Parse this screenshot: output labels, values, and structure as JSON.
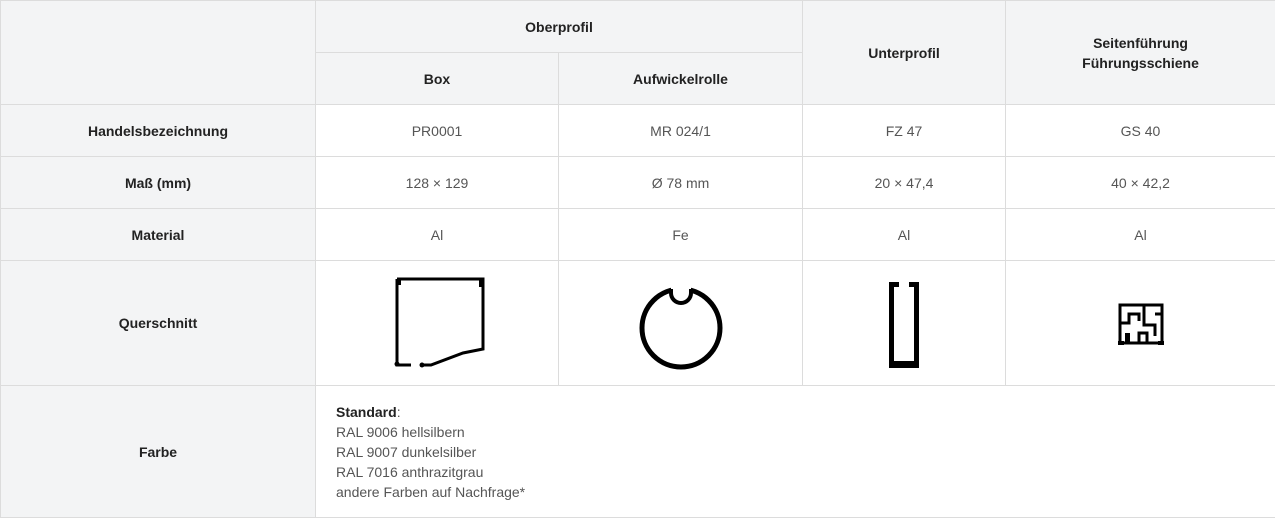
{
  "header": {
    "oberprofil": "Oberprofil",
    "box": "Box",
    "aufwickelrolle": "Aufwickelrolle",
    "unterprofil": "Unterprofil",
    "seitenfuehrung_line1": "Seitenführung",
    "seitenfuehrung_line2": "Führungsschiene"
  },
  "rows": {
    "handelsbezeichnung": {
      "label": "Handelsbezeichnung",
      "box": "PR0001",
      "rolle": "MR 024/1",
      "unterprofil": "FZ 47",
      "seite": "GS 40"
    },
    "mass": {
      "label": "Maß (mm)",
      "box": "128 × 129",
      "rolle": "Ø 78 mm",
      "unterprofil": "20 × 47,4",
      "seite": "40 × 42,2"
    },
    "material": {
      "label": "Material",
      "box": "Al",
      "rolle": "Fe",
      "unterprofil": "Al",
      "seite": "Al"
    },
    "querschnitt": {
      "label": "Querschnitt",
      "box_icon": "box-profile-cross-section",
      "rolle_icon": "roller-tube-cross-section",
      "unterprofil_icon": "bottom-profile-cross-section",
      "seite_icon": "guide-rail-cross-section"
    },
    "farbe": {
      "label": "Farbe",
      "standard_label": "Standard",
      "standard_suffix": ":",
      "options": [
        "RAL 9006 hellsilbern",
        "RAL 9007 dunkelsilber",
        "RAL 7016 anthrazitgrau",
        "andere Farben auf Nachfrage*"
      ]
    }
  }
}
